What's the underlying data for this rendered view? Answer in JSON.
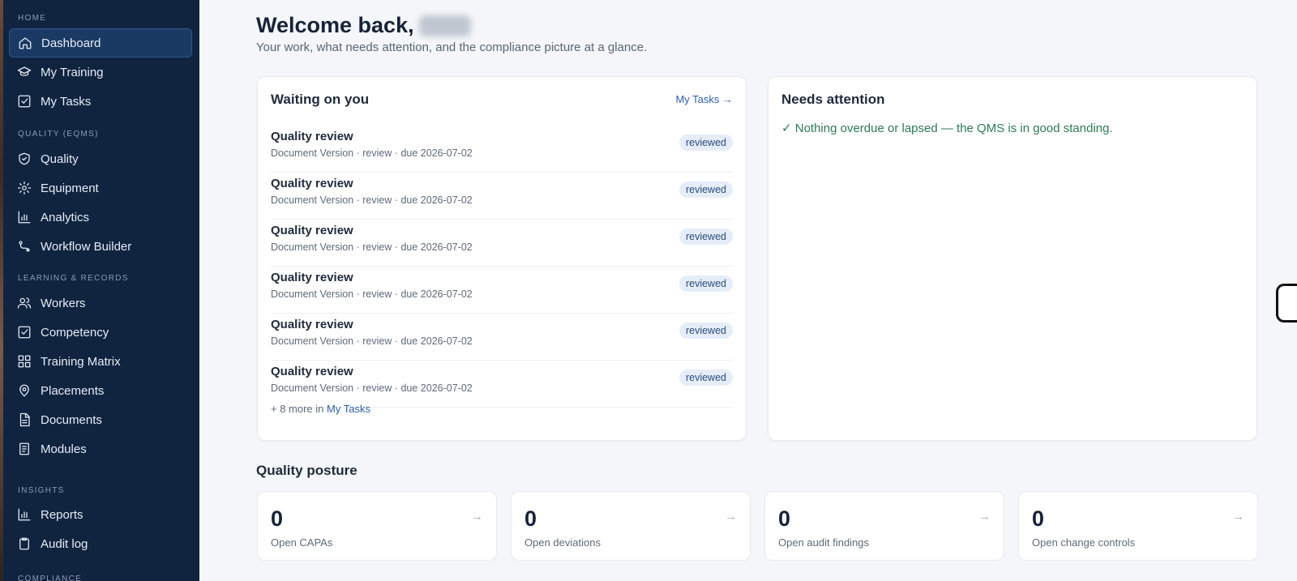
{
  "sidebar": {
    "sections": [
      {
        "label": "HOME",
        "items": [
          {
            "label": "Dashboard",
            "icon": "home-icon",
            "active": true
          },
          {
            "label": "My Training",
            "icon": "graduation-cap-icon"
          },
          {
            "label": "My Tasks",
            "icon": "check-square-icon"
          }
        ]
      },
      {
        "label": "QUALITY (EQMS)",
        "items": [
          {
            "label": "Quality",
            "icon": "shield-check-icon"
          },
          {
            "label": "Equipment",
            "icon": "gear-icon"
          },
          {
            "label": "Analytics",
            "icon": "bar-chart-icon"
          },
          {
            "label": "Workflow Builder",
            "icon": "workflow-icon"
          }
        ]
      },
      {
        "label": "LEARNING & RECORDS",
        "items": [
          {
            "label": "Workers",
            "icon": "users-icon"
          },
          {
            "label": "Competency",
            "icon": "check-square-icon"
          },
          {
            "label": "Training Matrix",
            "icon": "grid-icon"
          },
          {
            "label": "Placements",
            "icon": "map-pin-icon"
          },
          {
            "label": "Documents",
            "icon": "document-icon"
          },
          {
            "label": "Modules",
            "icon": "book-icon"
          }
        ]
      },
      {
        "label": "INSIGHTS",
        "items": [
          {
            "label": "Reports",
            "icon": "bar-chart-icon"
          },
          {
            "label": "Audit log",
            "icon": "clipboard-icon"
          }
        ]
      },
      {
        "label": "COMPLIANCE",
        "items": []
      }
    ]
  },
  "header": {
    "welcome": "Welcome back,",
    "subtitle": "Your work, what needs attention, and the compliance picture at a glance."
  },
  "waiting": {
    "title": "Waiting on you",
    "link": "My Tasks →",
    "tasks": [
      {
        "title": "Quality review",
        "meta": "Document Version · review · due 2026-07-02",
        "status": "reviewed"
      },
      {
        "title": "Quality review",
        "meta": "Document Version · review · due 2026-07-02",
        "status": "reviewed"
      },
      {
        "title": "Quality review",
        "meta": "Document Version · review · due 2026-07-02",
        "status": "reviewed"
      },
      {
        "title": "Quality review",
        "meta": "Document Version · review · due 2026-07-02",
        "status": "reviewed"
      },
      {
        "title": "Quality review",
        "meta": "Document Version · review · due 2026-07-02",
        "status": "reviewed"
      },
      {
        "title": "Quality review",
        "meta": "Document Version · review · due 2026-07-02",
        "status": "reviewed"
      }
    ],
    "more_prefix": "+ 8 more in",
    "more_link": "My Tasks"
  },
  "attention": {
    "title": "Needs attention",
    "message": "✓ Nothing overdue or lapsed — the QMS is in good standing."
  },
  "posture": {
    "title": "Quality posture",
    "metrics": [
      {
        "value": "0",
        "label": "Open CAPAs"
      },
      {
        "value": "0",
        "label": "Open deviations"
      },
      {
        "value": "0",
        "label": "Open audit findings"
      },
      {
        "value": "0",
        "label": "Open change controls"
      }
    ]
  },
  "colors": {
    "sidebar_bg": "#102440",
    "active_item_bg": "#1b3a63",
    "link": "#2f5fa8",
    "success": "#2f7a55",
    "badge_bg": "#e5edf8"
  }
}
